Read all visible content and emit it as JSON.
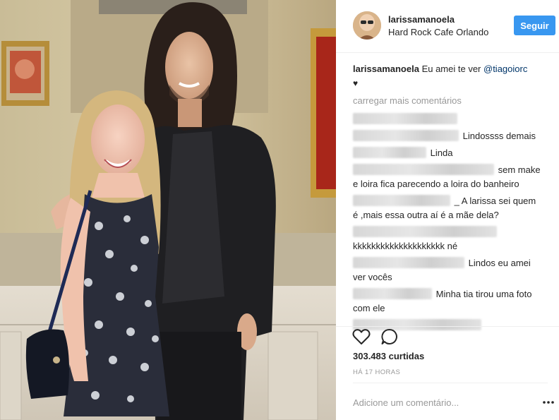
{
  "post": {
    "author": "larissamanoela",
    "location": "Hard Rock Cafe Orlando",
    "follow_label": "Seguir",
    "caption_user": "larissamanoela",
    "caption_text": " Eu amei te ver ",
    "caption_mention": "@tiagoiorc",
    "caption_heart": "♥",
    "load_more": "carregar mais comentários",
    "likes": "303.483 curtidas",
    "time": "HÁ 17 HORAS",
    "add_comment_placeholder": "Adicione um comentário...",
    "more_icon": "•••"
  },
  "comments": [
    {
      "text": ""
    },
    {
      "text": "Lindossss demais"
    },
    {
      "text": "Linda"
    },
    {
      "text": "sem make"
    },
    {
      "text": "e loira fica parecendo a loira do banheiro"
    },
    {
      "text": "_ A larissa sei quem"
    },
    {
      "text": "é ,mais essa outra aí é a mãe dela?"
    },
    {
      "text": ""
    },
    {
      "text": "kkkkkkkkkkkkkkkkkkkk né"
    },
    {
      "text": "Lindos eu amei"
    },
    {
      "text": "ver vocês"
    },
    {
      "text": "Minha tia tirou uma foto"
    },
    {
      "text": "com ele"
    },
    {
      "text": ""
    }
  ],
  "icons": {
    "like": "heart-outline-icon",
    "comment": "speech-bubble-icon",
    "more": "ellipsis-icon"
  },
  "colors": {
    "follow_button": "#3897f0",
    "mention": "#003569",
    "muted": "#999999",
    "text": "#262626"
  }
}
